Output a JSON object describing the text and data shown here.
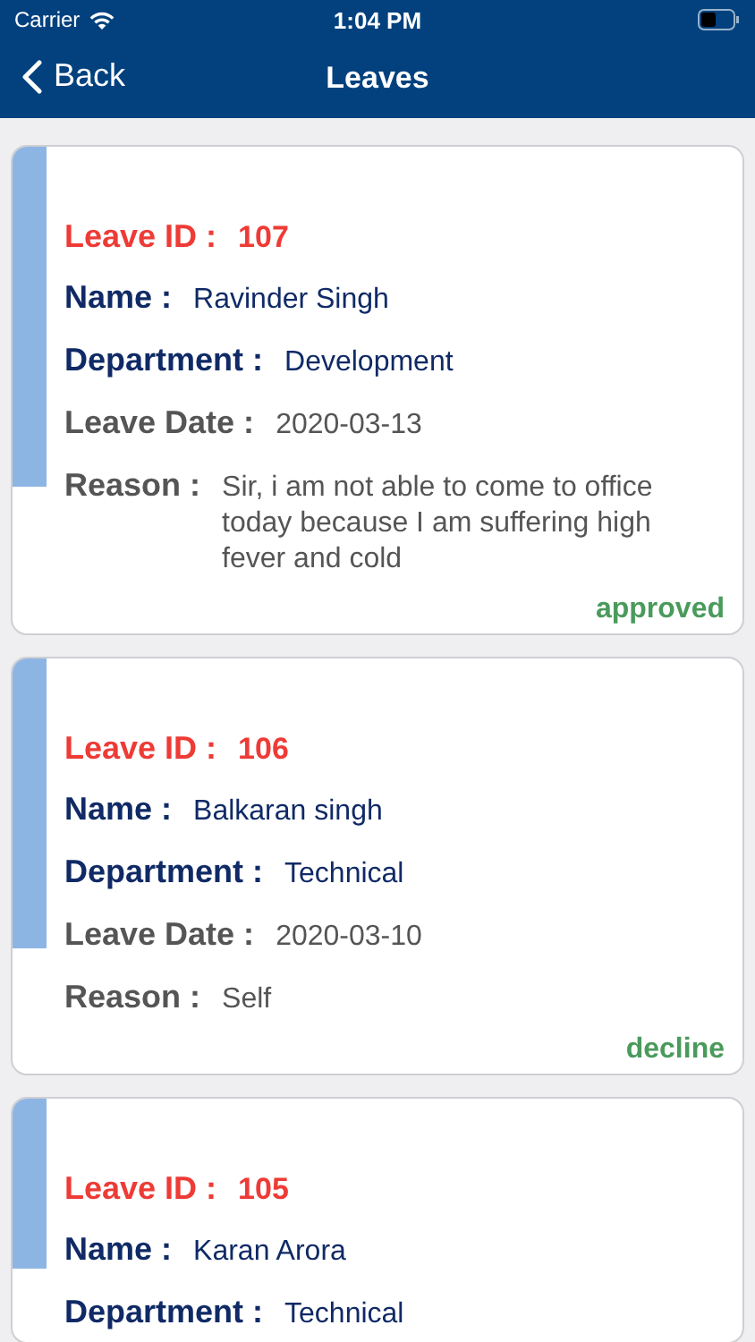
{
  "status_bar": {
    "carrier": "Carrier",
    "time": "1:04 PM"
  },
  "nav_bar": {
    "back": "Back",
    "title": "Leaves"
  },
  "leaves": [
    {
      "fields": [
        {
          "kind": "id",
          "label": "Leave ID :",
          "value": "107"
        },
        {
          "kind": "name",
          "label": "Name :",
          "value": "Ravinder Singh"
        },
        {
          "kind": "department",
          "label": "Department :",
          "value": "Development"
        },
        {
          "kind": "date",
          "label": "Leave Date :",
          "value": "2020-03-13"
        },
        {
          "kind": "reason",
          "label": "Reason :",
          "value": "Sir, i am not able to come to office today because I am suffering high fever and cold"
        }
      ],
      "status": "approved"
    },
    {
      "fields": [
        {
          "kind": "id",
          "label": "Leave ID :",
          "value": "106"
        },
        {
          "kind": "name",
          "label": "Name :",
          "value": "Balkaran singh"
        },
        {
          "kind": "department",
          "label": "Department :",
          "value": "Technical"
        },
        {
          "kind": "date",
          "label": "Leave Date :",
          "value": "2020-03-10"
        },
        {
          "kind": "reason",
          "label": "Reason :",
          "value": "Self"
        }
      ],
      "status": "decline"
    },
    {
      "fields": [
        {
          "kind": "id",
          "label": "Leave ID :",
          "value": "105"
        },
        {
          "kind": "name",
          "label": "Name :",
          "value": "Karan Arora"
        },
        {
          "kind": "department",
          "label": "Department :",
          "value": "Technical"
        }
      ]
    }
  ]
}
